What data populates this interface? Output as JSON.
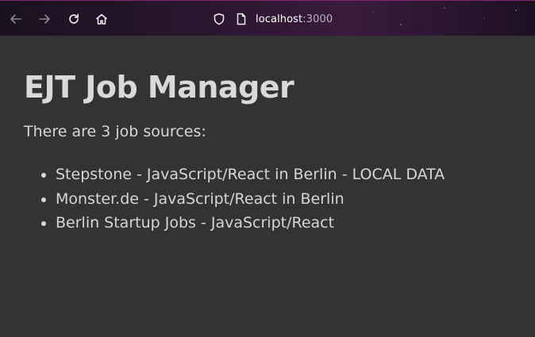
{
  "browser": {
    "url_host": "localhost",
    "url_port": ":3000"
  },
  "page": {
    "title": "EJT Job Manager",
    "intro": "There are 3 job sources:",
    "sources": [
      "Stepstone - JavaScript/React in Berlin - LOCAL DATA",
      "Monster.de - JavaScript/React in Berlin",
      "Berlin Startup Jobs - JavaScript/React"
    ]
  }
}
